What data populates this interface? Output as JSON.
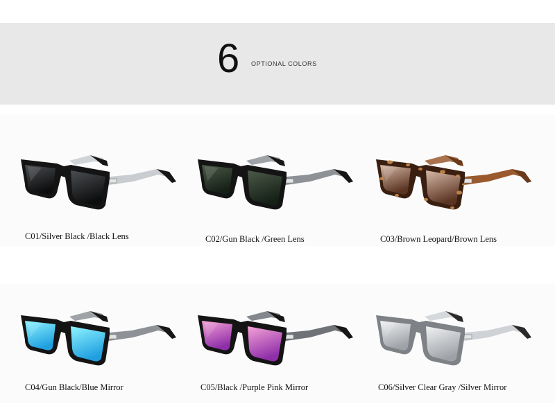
{
  "banner": {
    "number": "6",
    "text": "OPTIONAL COLORS"
  },
  "products": [
    {
      "label": "C01/Silver Black /Black Lens",
      "frame": "#141414",
      "temple": "#c9ccd0",
      "tip": "#161616",
      "lens_top": "#4b4e51",
      "lens_bottom": "#0c0d0e",
      "tortoise": false
    },
    {
      "label": "C02/Gun Black /Green Lens",
      "frame": "#141414",
      "temple": "#8e9297",
      "tip": "#161616",
      "lens_top": "#4b5a48",
      "lens_bottom": "#152016",
      "tortoise": false
    },
    {
      "label": "C03/Brown Leopard/Brown Lens",
      "frame": "#3a1f10",
      "temple": "#9a5a2e",
      "tip": "#6b3a1c",
      "lens_top": "#d7b9a8",
      "lens_bottom": "#5b3422",
      "tortoise": true
    },
    {
      "label": "C04/Gun Black/Blue Mirror",
      "frame": "#141414",
      "temple": "#8e9297",
      "tip": "#161616",
      "lens_top": "#8ff4ff",
      "lens_bottom": "#1f9fe0",
      "tortoise": false
    },
    {
      "label": "C05/Black /Purple Pink Mirror",
      "frame": "#141414",
      "temple": "#6f7378",
      "tip": "#161616",
      "lens_top": "#f6a3d8",
      "lens_bottom": "#8e2ea8",
      "tortoise": false
    },
    {
      "label": "C06/Silver Clear Gray /Silver Mirror",
      "frame": "#7e8185",
      "temple": "#cfd2d6",
      "tip": "#2a2a2a",
      "lens_top": "#f1f2f3",
      "lens_bottom": "#9ea2a7",
      "tortoise": false
    }
  ]
}
